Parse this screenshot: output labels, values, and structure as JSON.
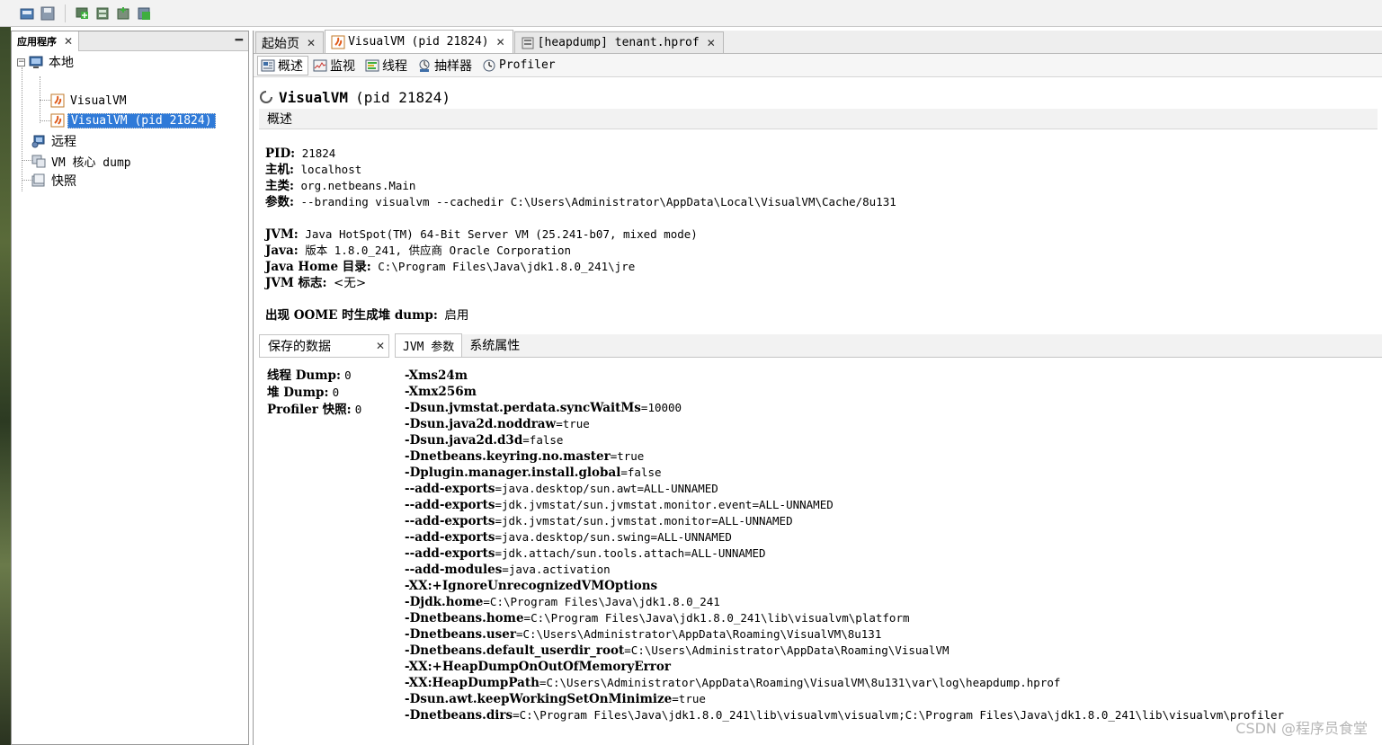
{
  "left_panel": {
    "tab_label": "应用程序",
    "tree": {
      "local": "本地",
      "local_children": [
        "VisualVM",
        "VisualVM (pid 21824)"
      ],
      "remote": "远程",
      "core_dump": "VM 核心 dump",
      "snapshots": "快照"
    }
  },
  "doc_tabs": [
    {
      "label": "起始页"
    },
    {
      "label": "VisualVM (pid 21824)"
    },
    {
      "label": "[heapdump] tenant.hprof"
    }
  ],
  "sub_tabs": [
    {
      "label": "概述",
      "icon": "overview-icon"
    },
    {
      "label": "监视",
      "icon": "monitor-icon"
    },
    {
      "label": "线程",
      "icon": "threads-icon"
    },
    {
      "label": "抽样器",
      "icon": "sampler-icon"
    },
    {
      "label": "Profiler",
      "icon": "profiler-icon"
    }
  ],
  "title": {
    "name": "VisualVM",
    "pid": "(pid 21824)"
  },
  "section_title": "概述",
  "info": {
    "pid": {
      "label": "PID:",
      "value": "21824"
    },
    "host": {
      "label": "主机:",
      "value": "localhost"
    },
    "main_class": {
      "label": "主类:",
      "value": "org.netbeans.Main"
    },
    "args": {
      "label": "参数:",
      "value": "--branding visualvm --cachedir C:\\Users\\Administrator\\AppData\\Local\\VisualVM\\Cache/8u131"
    },
    "jvm": {
      "label": "JVM:",
      "value": "Java HotSpot(TM) 64-Bit Server VM (25.241-b07, mixed mode)"
    },
    "java": {
      "label": "Java:",
      "value": "版本 1.8.0_241, 供应商 Oracle Corporation"
    },
    "java_home": {
      "label": "Java Home 目录:",
      "value": "C:\\Program Files\\Java\\jdk1.8.0_241\\jre"
    },
    "jvm_flags": {
      "label": "JVM 标志:",
      "value": "<无>"
    },
    "oome": {
      "label": "出现 OOME 时生成堆 dump:",
      "value": "启用"
    }
  },
  "bottom_tabs": {
    "saved_data": "保存的数据",
    "jvm_args": "JVM 参数",
    "sys_props": "系统属性"
  },
  "saved_data": [
    {
      "label": "线程 Dump:",
      "value": "0"
    },
    {
      "label": "堆 Dump:",
      "value": "0"
    },
    {
      "label": "Profiler 快照:",
      "value": "0"
    }
  ],
  "jvm_args": [
    {
      "key": "-Xms24m",
      "value": ""
    },
    {
      "key": "-Xmx256m",
      "value": ""
    },
    {
      "key": "-Dsun.jvmstat.perdata.syncWaitMs",
      "value": "=10000"
    },
    {
      "key": "-Dsun.java2d.noddraw",
      "value": "=true"
    },
    {
      "key": "-Dsun.java2d.d3d",
      "value": "=false"
    },
    {
      "key": "-Dnetbeans.keyring.no.master",
      "value": "=true"
    },
    {
      "key": "-Dplugin.manager.install.global",
      "value": "=false"
    },
    {
      "key": "--add-exports",
      "value": "=java.desktop/sun.awt=ALL-UNNAMED"
    },
    {
      "key": "--add-exports",
      "value": "=jdk.jvmstat/sun.jvmstat.monitor.event=ALL-UNNAMED"
    },
    {
      "key": "--add-exports",
      "value": "=jdk.jvmstat/sun.jvmstat.monitor=ALL-UNNAMED"
    },
    {
      "key": "--add-exports",
      "value": "=java.desktop/sun.swing=ALL-UNNAMED"
    },
    {
      "key": "--add-exports",
      "value": "=jdk.attach/sun.tools.attach=ALL-UNNAMED"
    },
    {
      "key": "--add-modules",
      "value": "=java.activation"
    },
    {
      "key": "-XX:+IgnoreUnrecognizedVMOptions",
      "value": ""
    },
    {
      "key": "-Djdk.home",
      "value": "=C:\\Program  Files\\Java\\jdk1.8.0_241"
    },
    {
      "key": "-Dnetbeans.home",
      "value": "=C:\\Program  Files\\Java\\jdk1.8.0_241\\lib\\visualvm\\platform"
    },
    {
      "key": "-Dnetbeans.user",
      "value": "=C:\\Users\\Administrator\\AppData\\Roaming\\VisualVM\\8u131"
    },
    {
      "key": "-Dnetbeans.default_userdir_root",
      "value": "=C:\\Users\\Administrator\\AppData\\Roaming\\VisualVM"
    },
    {
      "key": "-XX:+HeapDumpOnOutOfMemoryError",
      "value": ""
    },
    {
      "key": "-XX:HeapDumpPath",
      "value": "=C:\\Users\\Administrator\\AppData\\Roaming\\VisualVM\\8u131\\var\\log\\heapdump.hprof"
    },
    {
      "key": "-Dsun.awt.keepWorkingSetOnMinimize",
      "value": "=true"
    },
    {
      "key": "-Dnetbeans.dirs",
      "value": "=C:\\Program  Files\\Java\\jdk1.8.0_241\\lib\\visualvm\\visualvm;C:\\Program  Files\\Java\\jdk1.8.0_241\\lib\\visualvm\\profiler"
    }
  ],
  "watermark": "CSDN @程序员食堂",
  "colors": {
    "selection": "#2f7ad8",
    "tab_border": "#b9b9b9"
  }
}
